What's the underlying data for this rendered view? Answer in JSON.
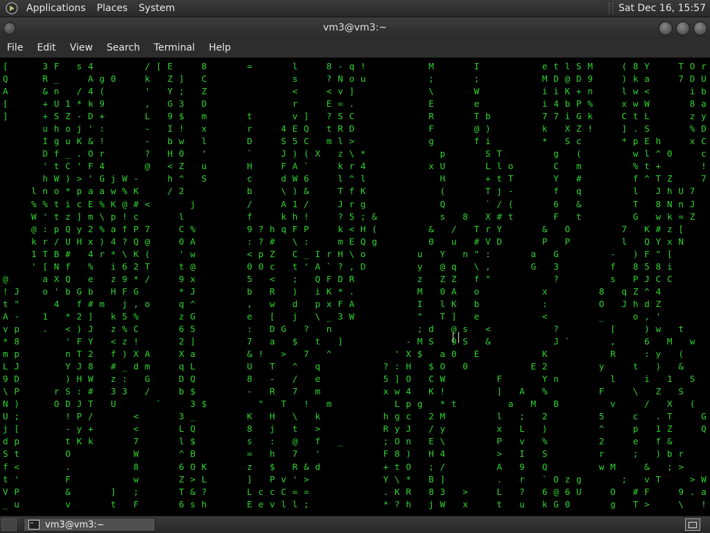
{
  "top_panel": {
    "menus": [
      "Applications",
      "Places",
      "System"
    ],
    "clock": "Sat Dec 16, 15:57"
  },
  "window": {
    "title": "vm3@vm3:~"
  },
  "menubar": {
    "items": [
      "File",
      "Edit",
      "View",
      "Search",
      "Terminal",
      "Help"
    ]
  },
  "terminal": {
    "screen": "[      3 F   s 4         / [ E     8       =       l     8 - q !           M       I           e t l S M     ( 8 Y     T O r   j     0 # 1           C :\nQ      R _     A g 0     k   Z ]   C               s     ? N o u           ;       ;           M D @ D 9     ) k a     7 D U   t     I D 3           O )\nA      & n   / 4 (       '   Y ;   Z               <     < v ]             \\       W           i i K + n     l w <       i b   > s 7 A O           + #\n[      + U 1 * k 9       ,   G 3   D               r     E = .             E       e           i 4 b P %     x w W       8 a   * 1 l * j           / Z\n]      + S Z - D +       L   9 $   m       t       v ]   ? S C             R       T b         7 7 i G k     C t L       z y Q K ` ( \\ j           q V\n       u h o j ' :       -   I !   x       r     4 E Q   t R D             F       @ )         k   X Z !     ] . S       % D 0 $ \"   K a           l m\n       I g u K & !       -   b w   l       D     S 5 C   m l >             g       f i         *   S c       * p E h     x C d = J   _ 9           L 9\n       D f _ . O r       ?   H 0   '       `     J ) ( X   z \\ *             p       S T         g   (         w l ^ 0     c   I J /   q ;           ;\n       ' t C ' F 4       @   < Z   u       H     F A `     k r 4           x U       L l o       C   m         % t +       ! f Q   p +           0\n       h W ) > ' G j W -     h ^   S       c     d W 6     l ^ l             H       + t T       Y   #         f ^ T Z     7   H   B b           >\n     l n o * p a a w % K     / 2           b     \\ ) &     T f K             (       T j -       f   q         l   J h U 7     t   w   H :           a\n     % % t i c E % K @ # <       j         /     A 1 /     J r g             Q       ` / (       6   &         T   8 N n J     5   A   X @           o\n     W ' t z ] m \\ p ! c       l           f     k h !     ? 5 ; &           s   8   X # t       F   t         G   w k = Z     _   v               o\n     @ : p Q y 2 % a f P 7     C %         9 ? h q F P     k < H (         &   /   T r Y       &   O         7   K # z [     O   i               V\n     k r / U H x ) 4 ? Q @     0 A         : ? #   \\ :     m E Q g         0   u   # V D       P   P         l   Q Y x N     A   R d           ;\n     1 T B #   4 r * \\ K (     ' w         < p Z   C _ I r H \\ o         u   Y   n \" :       a   G         -   ) F \" [         s 0       3   o\n     ' [ N f   %   i 6 2 T     t @         0 0 c   t ' A ` ? , D         y   @ q   \\ ,       G   3         f   8 5 8 i         T &       ,   x\n@      a X Q   e   z 9 * /     9 x         5   <   ;   Q F D R           z   Z Z   f \"           ?         s   P J C C         = <       :   w\n! J    o ' b G b   H F G       * J         b   R   )   i K * .           M   0 A   o           x         8   q Z ^ 4         X ]       D , )\nt \"      4   f # m   j , o     q ^         ,   w   d   p x F A           I   l K   b           :         O   J h d Z         0 O       * ! C\nA -    1   * 2 ]   k 5 %       z G         e   [   j   \\ _ 3 W           \"   T ]   e           <         _     o , '         X p B A   ) < N\nv p    .   < ) J   z % C       6 5         :   D G   ?   n               ; d   @ s   <           ?         [     ) w   t     I ` W   U D o C\n* 8        ' F Y   < z !       2 ]         7   a   $   t   ]           - M S   9 S   &           J `       ,     6   M   w     p - X   X - ^ :\nm p        n T 2   f ) X A     X a         & !   >   7   ^           ' X $   a 0   E           K           R     : y   (     t & j   p c \"\nL J        Y J 8   # _ d m     q L         U   T   ^   q           ? : H   $ O   0           E 2         y     t   )   &     . 0 G     [ b\n9 D        ) H W   z :   G     D Q         8   -   /   e           5 ] O   C W         F       Y n         l     i   1   S     6 E H     : O\n\\ P      r S : #   3 3   /     b $         -   R   7   m           x w 4   K !         ]   A   %         F     \\   Z   S     e G 3     9 q\nN )      O D J T   U       `     3 $         \"   T   !   m           L p g   * t         a   M   B         v     /   X   (     ) ] 6     m 4   >\nU ;        ! P /       <       3 _         K   H   \\   k           h g c   2 M         l   ;   2         5     c   . T     G . `     @     c\nj [        - y +       <       L Q         8   j   t   >           R y J   / y         x   L   )         ^     p   1 Z     Q - d     x     Y\nd p        t K k       7       l $         s   :   @   f   _       ; O n   E \\         P   v   %         2     e   f &       B     f 2     7\nS t        O           W       ^ B         =   h   7   '           F 8 )   H 4         >   I   S         r     ;   ) b r       7     Y t     R\nf <        .           8       6 O K       z   $   R & d           + t O   ; /         A   9   Q         w M     &   ; >     P O     2 /     r\nt '        F           w       Z > L       ]   P v ' >             Y \\ *   B ]         .   r   ` O z g       ;   v T     > W ?     < '     h\nV P        &       ]   ;       T & ?       L c c C = =             . K R   8 3   >     L   ?   6 @ 6 U     O   # F     9 . a     5 C     C p !\n_ u        v       t   F       6 s h       E e v l l ;             * ? h   j W   x     t   u   k G 0       g   T >     \\   ! i     ; ;     J Q %"
  }
}
